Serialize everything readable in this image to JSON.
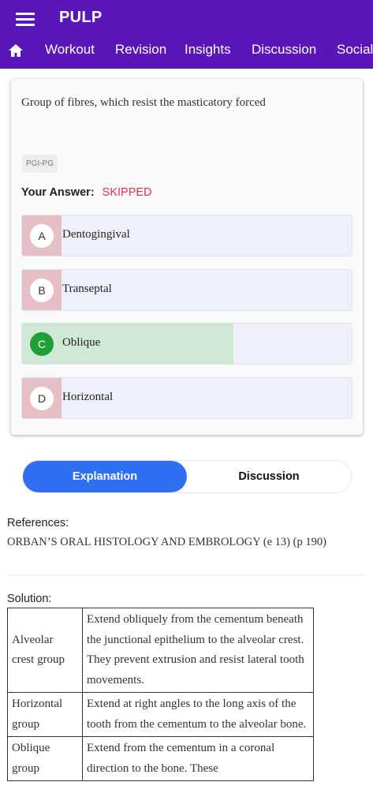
{
  "app": {
    "title": "PULP",
    "accent": "#5a16b8"
  },
  "nav": {
    "tabs": [
      "Workout",
      "Revision",
      "Insights",
      "Discussion",
      "Social"
    ]
  },
  "question": {
    "text": "Group of fibres, which resist the masticatory forced",
    "tag": "PGI-PG",
    "answer_label": "Your Answer:",
    "answer_value": "SKIPPED"
  },
  "options": [
    {
      "letter": "A",
      "text": "Dentogingival",
      "status": "other",
      "percent": 12
    },
    {
      "letter": "B",
      "text": "Transeptal",
      "status": "other",
      "percent": 12
    },
    {
      "letter": "C",
      "text": "Oblique",
      "status": "correct",
      "percent": 64
    },
    {
      "letter": "D",
      "text": "Horizontal",
      "status": "other",
      "percent": 12
    }
  ],
  "segment": {
    "active": "Explanation",
    "inactive": "Discussion"
  },
  "references": {
    "heading": "References:",
    "text": "ORBAN’S ORAL HISTOLOGY AND EMBROLOGY (e 13) (p 190)"
  },
  "solution": {
    "heading": "Solution:",
    "rows": [
      {
        "name": "Alveolar crest group",
        "desc": "Extend obliquely from the cementum beneath the junctional epithelium to the alveolar crest. They prevent extrusion and resist lateral tooth movements."
      },
      {
        "name": "Horizontal group",
        "desc": "Extend at right angles to the long axis of the tooth from the cementum to the alveolar bone."
      },
      {
        "name": "Oblique group",
        "desc": "Extend from the cementum in a coronal direction to the bone. These"
      }
    ]
  }
}
